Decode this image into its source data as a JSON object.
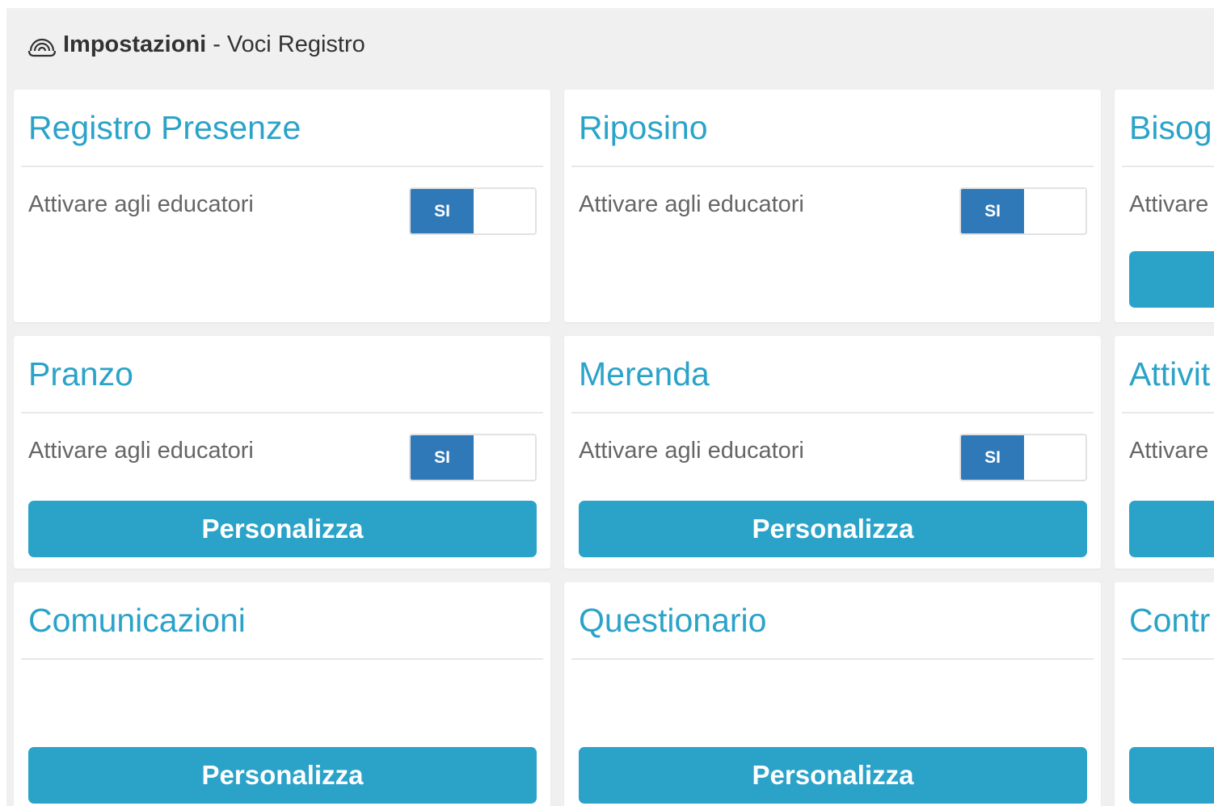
{
  "header": {
    "strong": "Impostazioni",
    "separator": "-",
    "subtitle": "Voci Registro",
    "icon": "rainbow-icon"
  },
  "colors": {
    "accent": "#2ba3c9",
    "toggle_on": "#3079b8",
    "panel_bg": "#f0f0f0"
  },
  "cards": [
    {
      "title": "Registro Presenze",
      "label": "Attivare agli educatori",
      "toggle": "SI",
      "button": ""
    },
    {
      "title": "Riposino",
      "label": "Attivare agli educatori",
      "toggle": "SI",
      "button": ""
    },
    {
      "title": "Bisog",
      "label": "Attivare",
      "toggle": "",
      "button": ""
    },
    {
      "title": "Pranzo",
      "label": "Attivare agli educatori",
      "toggle": "SI",
      "button": "Personalizza"
    },
    {
      "title": "Merenda",
      "label": "Attivare agli educatori",
      "toggle": "SI",
      "button": "Personalizza"
    },
    {
      "title": "Attivit",
      "label": "Attivare",
      "toggle": "",
      "button": ""
    },
    {
      "title": "Comunicazioni",
      "label": "",
      "toggle": "",
      "button": "Personalizza"
    },
    {
      "title": "Questionario",
      "label": "",
      "toggle": "",
      "button": "Personalizza"
    },
    {
      "title": "Contr",
      "label": "",
      "toggle": "",
      "button": ""
    }
  ]
}
